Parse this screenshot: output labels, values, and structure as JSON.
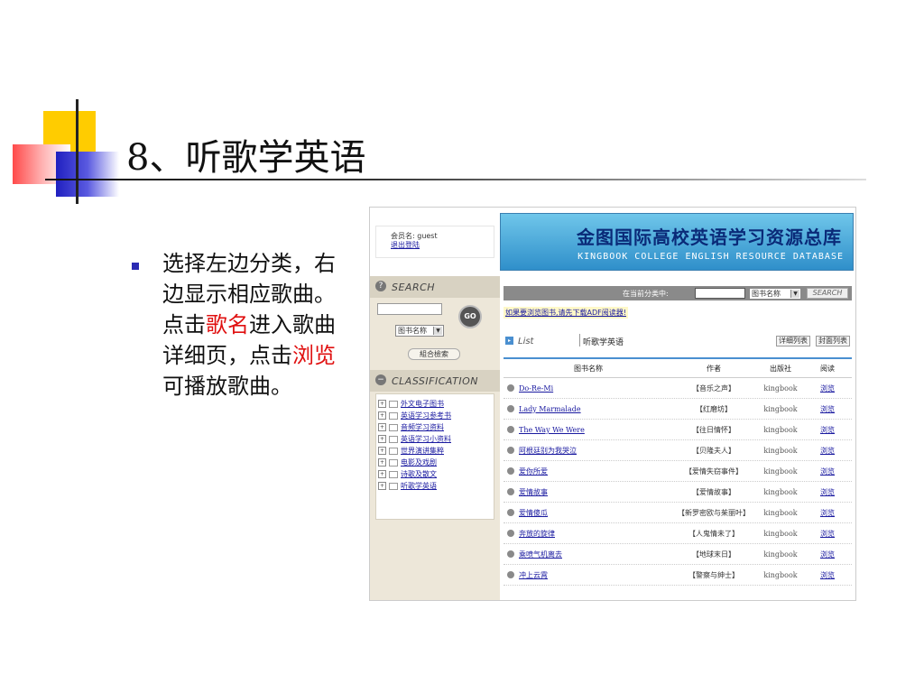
{
  "slide": {
    "title": "8、听歌学英语",
    "bullet_parts": [
      "选择左边分类，右边显示相应歌曲。点击",
      "歌名",
      "进入歌曲详细页，点击",
      "浏览",
      "可播放歌曲。"
    ]
  },
  "screenshot": {
    "user": {
      "member_label": "会员名: guest",
      "logout": "退出登陆"
    },
    "banner": {
      "title_cn": "金图国际高校英语学习资源总库",
      "title_en": "KINGBOOK COLLEGE ENGLISH RESOURCE DATABASE"
    },
    "search": {
      "heading": "SEARCH",
      "input_value": "",
      "field_select": "图书名称",
      "go_label": "GO",
      "combo_label": "組合檢索"
    },
    "classification": {
      "heading": "CLASSIFICATION",
      "items": [
        "外文电子图书",
        "英语学习参考书",
        "音频学习资料",
        "英语学习小资料",
        "世界演讲集粹",
        "电影及戏剧",
        "诗歌及散文",
        "听歌学英语"
      ]
    },
    "topbar": {
      "current_label": "在当前分类中:",
      "field_select": "图书名称",
      "search_label": "SEARCH"
    },
    "notice": "如果要浏览图书,请先下载ADF阅读器!",
    "list": {
      "label": "List",
      "category": "听歌学英语",
      "view_detail": "详细列表",
      "view_cover": "封面列表"
    },
    "table": {
      "headers": [
        "图书名称",
        "作者",
        "出版社",
        "阅读"
      ],
      "rows": [
        {
          "name": "Do-Re-Mi",
          "author": "【音乐之声】",
          "publisher": "kingbook",
          "action": "浏览"
        },
        {
          "name": "Lady Marmalade",
          "author": "【红磨坊】",
          "publisher": "kingbook",
          "action": "浏览"
        },
        {
          "name": "The Way We Were",
          "author": "【往日情怀】",
          "publisher": "kingbook",
          "action": "浏览"
        },
        {
          "name": "阿根廷别为我哭泣",
          "author": "【贝隆夫人】",
          "publisher": "kingbook",
          "action": "浏览"
        },
        {
          "name": "爱你所爱",
          "author": "【爱情失窃事件】",
          "publisher": "kingbook",
          "action": "浏览"
        },
        {
          "name": "爱情故事",
          "author": "【爱情故事】",
          "publisher": "kingbook",
          "action": "浏览"
        },
        {
          "name": "爱情傻瓜",
          "author": "【新罗密欧与茱丽叶】",
          "publisher": "kingbook",
          "action": "浏览"
        },
        {
          "name": "奔放的旋律",
          "author": "【人鬼情未了】",
          "publisher": "kingbook",
          "action": "浏览"
        },
        {
          "name": "乘喷气机离去",
          "author": "【地球末日】",
          "publisher": "kingbook",
          "action": "浏览"
        },
        {
          "name": "冲上云霄",
          "author": "【警察与绅士】",
          "publisher": "kingbook",
          "action": "浏览"
        }
      ]
    }
  }
}
